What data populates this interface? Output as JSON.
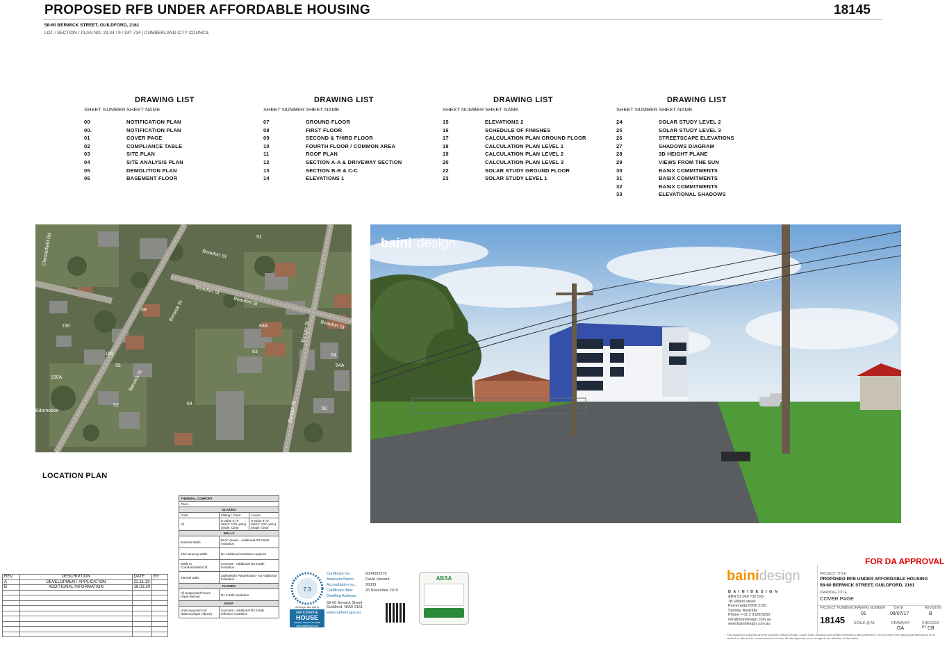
{
  "header": {
    "title": "PROPOSED RFB UNDER AFFORDABLE HOUSING",
    "project_number": "18145",
    "address": "58-60 BERWICK STREET, GUILDFORD, 2161",
    "lot": "LOT / SECTION / PLAN NO: 29,34 / 9 / DP: 734 | CUMBERLAND CITY COUNCIL"
  },
  "drawing_list": {
    "heading": "DRAWING LIST",
    "col_sheet_number": "SHEET NUMBER",
    "col_sheet_name": "SHEET NAME",
    "columns": [
      [
        [
          "00",
          "NOTIFICATION PLAN"
        ],
        [
          "00.",
          "NOTIFICATION PLAN"
        ],
        [
          "01",
          "COVER PAGE"
        ],
        [
          "02",
          "COMPLIANCE TABLE"
        ],
        [
          "03",
          "SITE PLAN"
        ],
        [
          "04",
          "SITE ANALYSIS PLAN"
        ],
        [
          "05",
          "DEMOLITION PLAN"
        ],
        [
          "06",
          "BASEMENT FLOOR"
        ]
      ],
      [
        [
          "07",
          "GROUND FLOOR"
        ],
        [
          "08",
          "FIRST FLOOR"
        ],
        [
          "09",
          "SECOND & THIRD FLOOR"
        ],
        [
          "10",
          "FOURTH FLOOR / COMMON AREA"
        ],
        [
          "11",
          "ROOF PLAN"
        ],
        [
          "12",
          "SECTION A-A & DRIVEWAY SECTION"
        ],
        [
          "13",
          "SECTION B-B & C-C"
        ],
        [
          "14",
          "ELEVATIONS 1"
        ]
      ],
      [
        [
          "15",
          "ELEVATIONS 2"
        ],
        [
          "16",
          "SCHEDULE OF FINISHES"
        ],
        [
          "17",
          "CALCULATION PLAN GROUND FLOOR"
        ],
        [
          "18",
          "CALCULATION PLAN LEVEL 1"
        ],
        [
          "19",
          "CALCULATION PLAN LEVEL 2"
        ],
        [
          "20",
          "CALCULATION PLAN LEVEL 3"
        ],
        [
          "22",
          "SOLAR STUDY GROUND FLOOR"
        ],
        [
          "23",
          "SOLAR STUDY  LEVEL 1"
        ]
      ],
      [
        [
          "24",
          "SOLAR STUDY LEVEL 2"
        ],
        [
          "25",
          "SOLAR STUDY LEVEL 3"
        ],
        [
          "26",
          "STREETSCAPE ELEVATIONS"
        ],
        [
          "27",
          "SHADOWS DIAGRAM"
        ],
        [
          "28",
          "3D HEIGHT PLANE"
        ],
        [
          "29",
          "VIEWS FROM THE SUN"
        ],
        [
          "30",
          "BASIX COMMITMENTS"
        ],
        [
          "31",
          "BASIX COMMITMENTS"
        ],
        [
          "32",
          "BASIX COMMITMENTS"
        ],
        [
          "33",
          "ELEVATIONAL SHADOWS"
        ]
      ]
    ]
  },
  "map": {
    "streets": [
      "Beaufort St",
      "Beaufort St",
      "Beaufort St",
      "Berwick St",
      "Berwick St",
      "Bangor St",
      "Bangor St",
      "Chesterfield Rd"
    ],
    "labels": [
      "63A",
      "63",
      "54",
      "64",
      "60",
      "55",
      "190A",
      "150",
      "156",
      "52",
      "54A",
      "51",
      "59",
      "Beaufort St",
      "Edomotive"
    ]
  },
  "location_plan": "LOCATION PLAN",
  "render": {
    "brand_bold": "baini",
    "brand_light": "design"
  },
  "revision_table": {
    "headers": [
      "REV",
      "DESCRIPTION",
      "DATE",
      "BY"
    ],
    "rows": [
      [
        "A",
        "DEVELOPMENT APPLICATION",
        "22.11.19",
        ""
      ],
      [
        "B",
        "ADDITIONAL INFORMATION",
        "18.03.20",
        ""
      ]
    ],
    "blank_rows": 9
  },
  "thermal": {
    "title": "THERMAL COMFORT",
    "pass": "Pass --",
    "glazing": "GLAZING",
    "glazing_headers": [
      "Units",
      "Sliding / Fixed",
      "Louvre"
    ],
    "glazing_row": [
      "All",
      "U-value 6.70 SHGC 0.70 (±5%) Single, Clear",
      "U-value 6.70 SHGC 0.57 (±5%) Single, Clear"
    ],
    "walls": "WALLS",
    "walls_rows": [
      [
        "External Walls",
        "Brick Veneer - Additional R2.5 Bulk Insulation"
      ],
      [
        "Inter-tenancy Walls",
        "No Additional Insulation required"
      ],
      [
        "Walls to Corridors/Stairs/Lift",
        "Concrete - Additional R2.5 Bulk Insulation"
      ],
      [
        "Internal walls",
        "Lightweight Plasterboard - No Additional Insulation"
      ]
    ],
    "floors": "FLOORS",
    "floors_rows": [
      [
        "All Suspended Floors (Open Below)",
        "R1.0 Bulk Insulation"
      ]
    ],
    "roof": "ROOF",
    "roof_rows": [
      [
        "Units exposed roof (Balcony/Open Above)",
        "Concrete - Additional R2.5 Bulk reflective insulation"
      ]
    ]
  },
  "nathers": {
    "rating": "7.3",
    "avg": "Average star rating",
    "nationwide": "NATIONWIDE",
    "house": "HOUSE",
    "scheme": "ENERGY RATING SCHEME",
    "web": "www.nathers.gov.au",
    "labels": [
      "Certificate no.:",
      "Assessor Name:",
      "Accreditation no.:",
      "Certificate date:",
      "Dwelling Address:"
    ],
    "values": [
      "0004392570",
      "David Howard",
      "20039",
      "26 November 2019"
    ],
    "address": "58-60 Berwick Street Guildford, NSW 2161",
    "footer_web": "www.nathers.gov.au"
  },
  "absa": {
    "logo": "ABSA"
  },
  "approval": "FOR DA APPROVAL",
  "titleblock": {
    "brand_bold": "baini",
    "brand_light": "design",
    "firm": "B A I N I   D E S I G N",
    "contact": [
      "ABN 51 068 732 593",
      "1B Villiers street",
      "Parramatta  NSW 2150",
      "Sydney, Australia",
      "Phone + 61 2 9188 8250",
      "info@bainidesign.com.au",
      "www.bainidesign.com.au"
    ],
    "project_title_label": "PROJECT TITLE",
    "project_title": "PROPOSED RFB UNDER AFFORDABLE HOUSING",
    "project_address": "58-60 BERWICK STREET, GUILDFORD, 2161",
    "drawing_title_label": "DRAWING TITLE",
    "drawing_title": "COVER PAGE",
    "fields": [
      [
        "PROJECT NUMBER",
        ""
      ],
      [
        "DRAWING NUMBER",
        "01"
      ],
      [
        "DATE",
        "06/07/17"
      ],
      [
        "REVISION",
        "B"
      ],
      [
        "SCALE @ A1",
        ""
      ],
      [
        "DRAWN BY",
        "GA"
      ],
      [
        "CHECKED BY",
        "CB"
      ]
    ],
    "project_number": "18145",
    "copyright": "This drawing is copyright and the property of Baini Design. Larger scale drawings and written dimensions take preference. Do not scale from drawing all dimensions to be verified on site before commencement of work. All discrepancies to be brought to the attention of the author."
  },
  "colors": {
    "accent": "#f39200",
    "approval": "#e00000"
  }
}
